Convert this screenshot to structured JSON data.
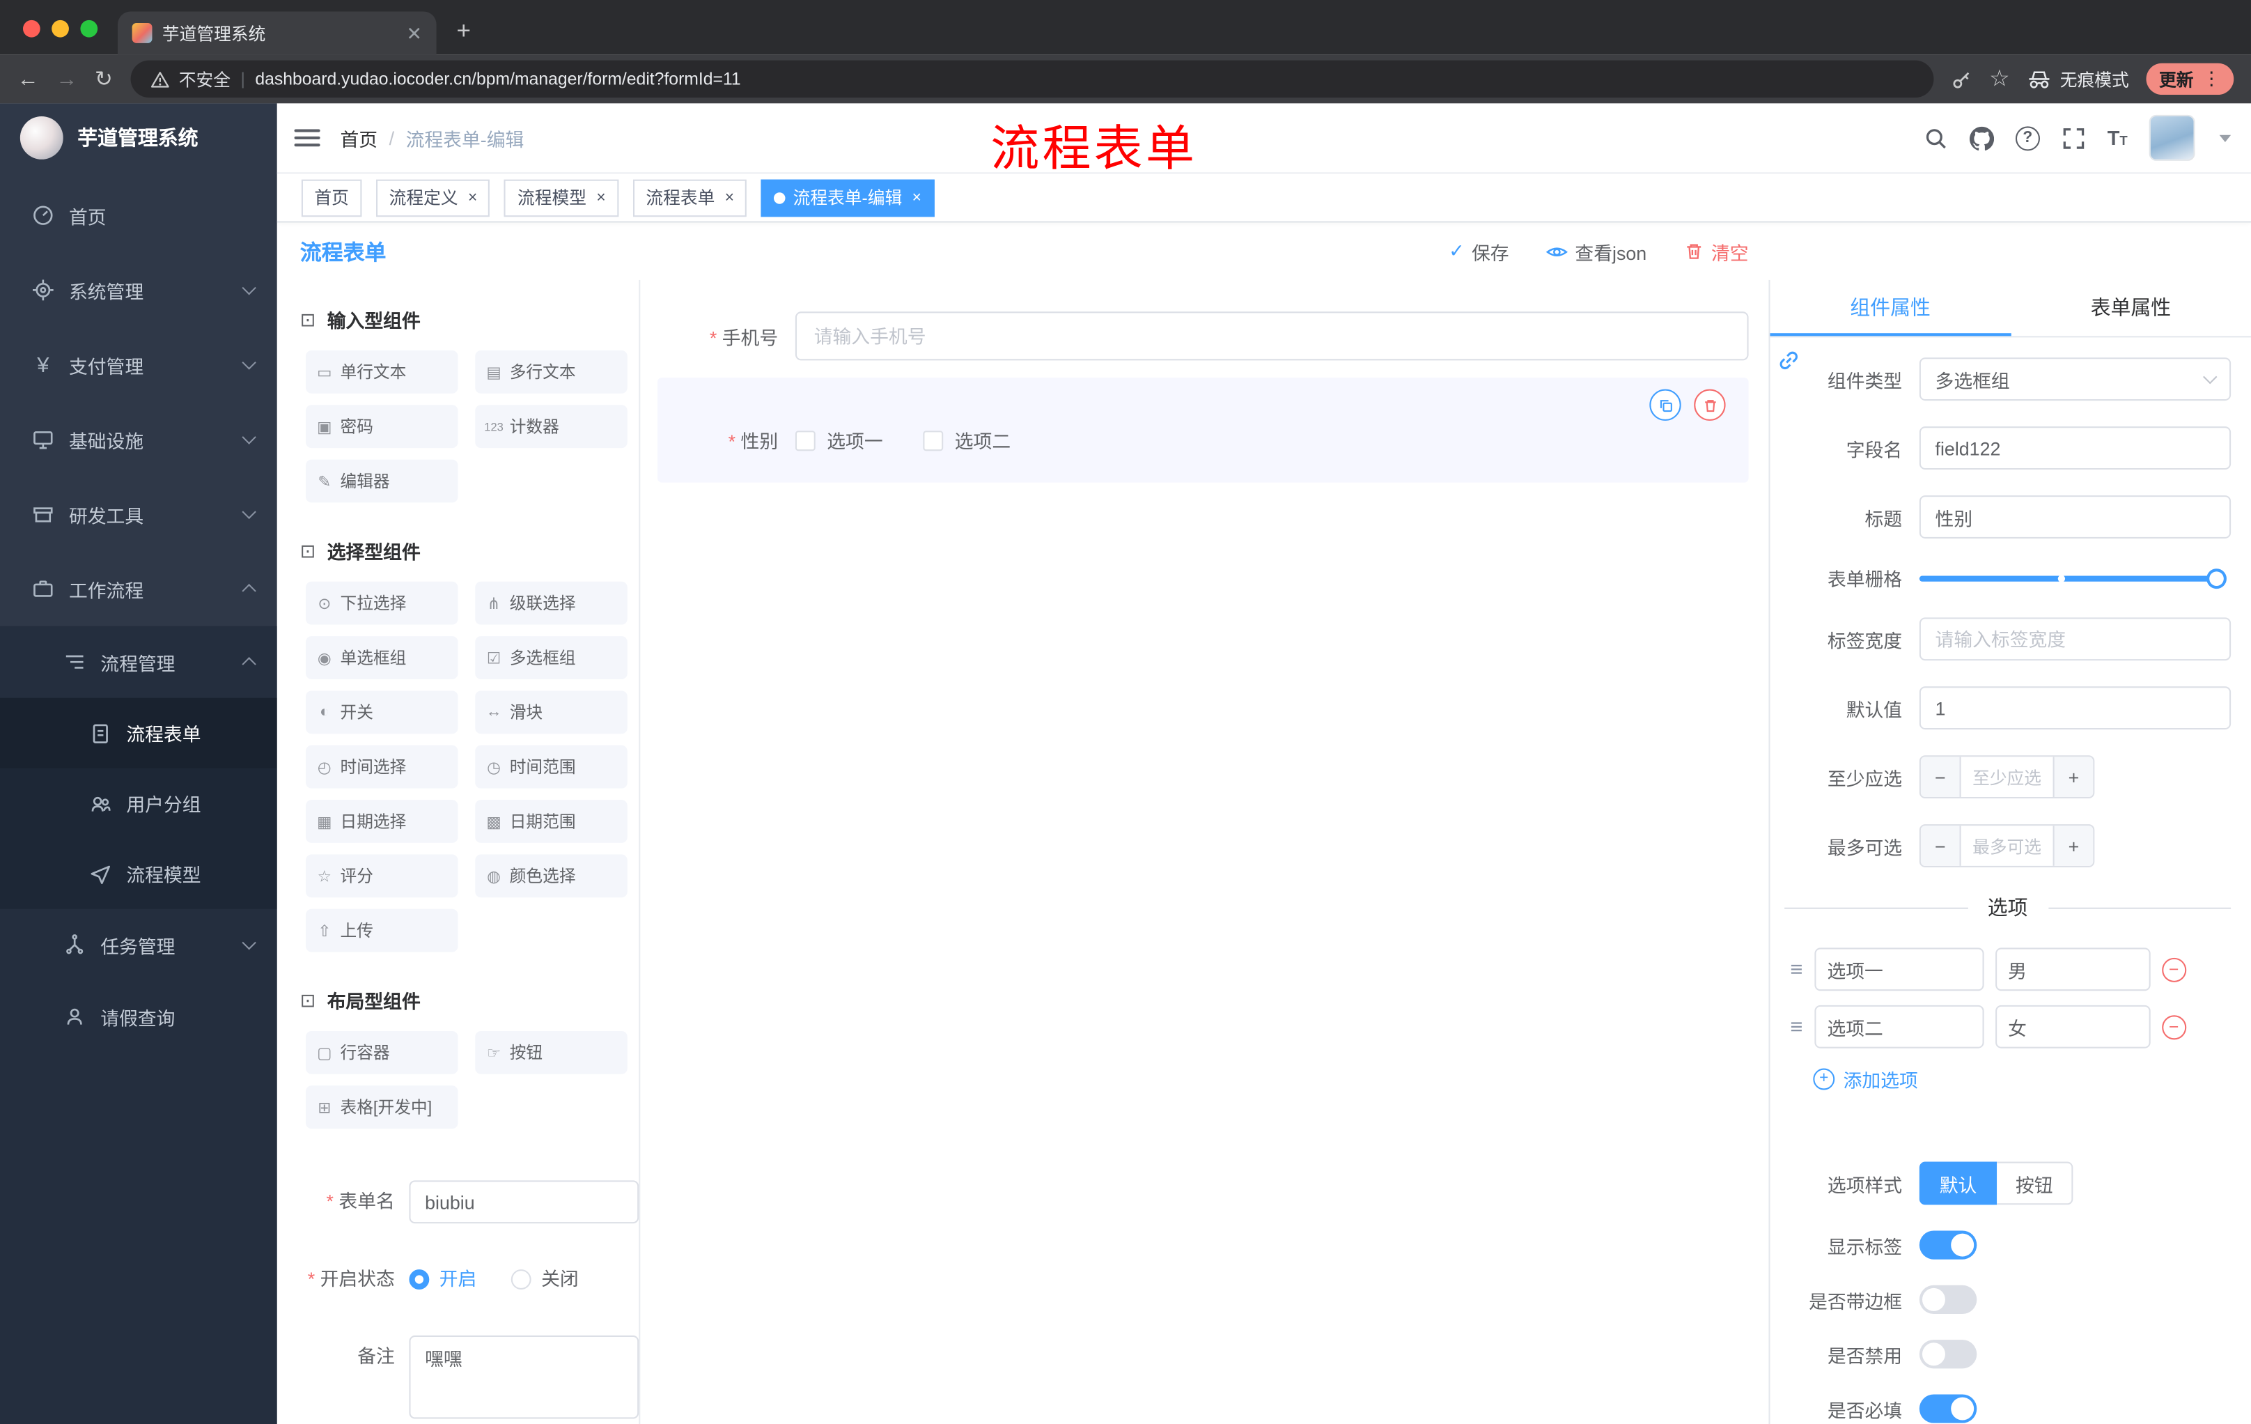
{
  "chrome": {
    "tab_title": "芋道管理系统",
    "security_label": "不安全",
    "url": "dashboard.yudao.iocoder.cn/bpm/manager/form/edit?formId=11",
    "incognito_label": "无痕模式",
    "update_label": "更新"
  },
  "sidebar": {
    "brand": "芋道管理系统",
    "home": "首页",
    "system": "系统管理",
    "payment": "支付管理",
    "infra": "基础设施",
    "devtools": "研发工具",
    "workflow": "工作流程",
    "process_mgmt": "流程管理",
    "process_form": "流程表单",
    "user_group": "用户分组",
    "process_model": "流程模型",
    "task_mgmt": "任务管理",
    "leave_query": "请假查询"
  },
  "navbar": {
    "breadcrumb_home": "首页",
    "breadcrumb_current": "流程表单-编辑",
    "annotation": "流程表单"
  },
  "tags": {
    "t0": "首页",
    "t1": "流程定义",
    "t2": "流程模型",
    "t3": "流程表单",
    "t4": "流程表单-编辑"
  },
  "designer": {
    "title": "流程表单",
    "save": "保存",
    "view_json": "查看json",
    "clear": "清空"
  },
  "palette": {
    "sections": [
      {
        "title": "输入型组件",
        "items": [
          {
            "icon": "▭",
            "label": "单行文本"
          },
          {
            "icon": "▤",
            "label": "多行文本"
          },
          {
            "icon": "▣",
            "label": "密码"
          },
          {
            "icon": "123",
            "label": "计数器"
          },
          {
            "icon": "✎",
            "label": "编辑器"
          }
        ]
      },
      {
        "title": "选择型组件",
        "items": [
          {
            "icon": "⊙",
            "label": "下拉选择"
          },
          {
            "icon": "⋔",
            "label": "级联选择"
          },
          {
            "icon": "◉",
            "label": "单选框组"
          },
          {
            "icon": "☑",
            "label": "多选框组"
          },
          {
            "icon": "◐",
            "label": "开关"
          },
          {
            "icon": "↔",
            "label": "滑块"
          },
          {
            "icon": "◴",
            "label": "时间选择"
          },
          {
            "icon": "◷",
            "label": "时间范围"
          },
          {
            "icon": "▦",
            "label": "日期选择"
          },
          {
            "icon": "▩",
            "label": "日期范围"
          },
          {
            "icon": "☆",
            "label": "评分"
          },
          {
            "icon": "◍",
            "label": "颜色选择"
          },
          {
            "icon": "⇧",
            "label": "上传"
          }
        ]
      },
      {
        "title": "布局型组件",
        "items": [
          {
            "icon": "▢",
            "label": "行容器"
          },
          {
            "icon": "☞",
            "label": "按钮"
          },
          {
            "icon": "⊞",
            "label": "表格[开发中]"
          }
        ]
      }
    ],
    "form": {
      "name_label": "表单名",
      "name_value": "biubiu",
      "status_label": "开启状态",
      "status_on": "开启",
      "status_off": "关闭",
      "remark_label": "备注",
      "remark_value": "嘿嘿"
    }
  },
  "canvas": {
    "phone_label": "手机号",
    "phone_placeholder": "请输入手机号",
    "gender_label": "性别",
    "opt1": "选项一",
    "opt2": "选项二"
  },
  "props": {
    "tab_component": "组件属性",
    "tab_form": "表单属性",
    "type_label": "组件类型",
    "type_value": "多选框组",
    "field_label": "字段名",
    "field_value": "field122",
    "title_label": "标题",
    "title_value": "性别",
    "grid_label": "表单栅格",
    "label_width_label": "标签宽度",
    "label_width_placeholder": "请输入标签宽度",
    "default_label": "默认值",
    "default_value": "1",
    "min_label": "至少应选",
    "min_placeholder": "至少应选",
    "max_label": "最多可选",
    "max_placeholder": "最多可选",
    "options_title": "选项",
    "options": [
      {
        "label": "选项一",
        "value": "男"
      },
      {
        "label": "选项二",
        "value": "女"
      }
    ],
    "add_option": "添加选项",
    "style_label": "选项样式",
    "style_default": "默认",
    "style_button": "按钮",
    "toggle_show_label": "显示标签",
    "toggle_show_on": true,
    "toggle_border_label": "是否带边框",
    "toggle_border_on": false,
    "toggle_disabled_label": "是否禁用",
    "toggle_disabled_on": false,
    "toggle_required_label": "是否必填",
    "toggle_required_on": true,
    "accent_color": "#409eff",
    "danger_color": "#f56c6c"
  }
}
